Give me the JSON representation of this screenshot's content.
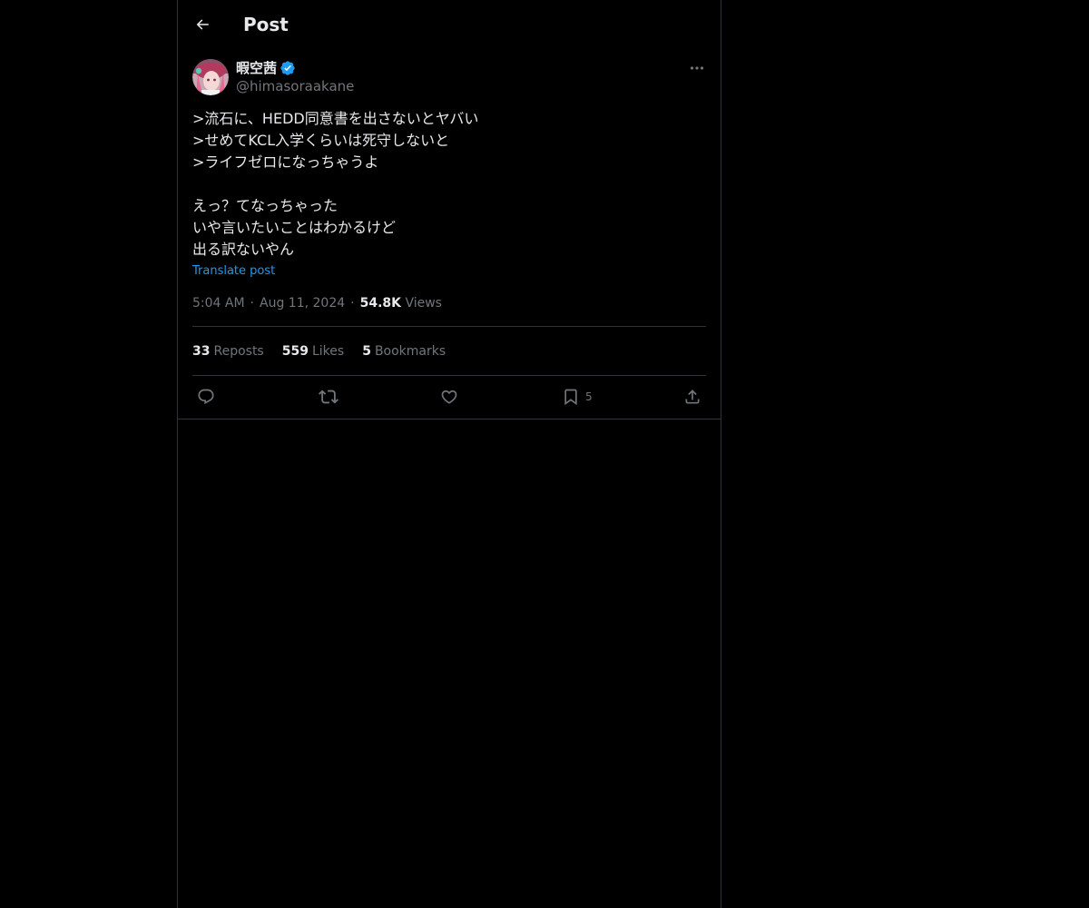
{
  "header": {
    "title": "Post",
    "back_icon": "arrow-left-icon"
  },
  "author": {
    "display_name": "暇空茜",
    "handle": "@himasoraakane",
    "verified": true,
    "verified_color": "#1d9bf0"
  },
  "post": {
    "lines": [
      ">流石に、HEDD同意書を出さないとヤバい",
      ">せめてKCL入学くらいは死守しないと",
      ">ライフゼロになっちゃうよ",
      "",
      "えっ？てなっちゃった",
      "いや言いたいことはわかるけど",
      "出る訳ないやん"
    ],
    "translate_label": "Translate post"
  },
  "meta": {
    "time": "5:04 AM",
    "separator": "·",
    "date": "Aug 11, 2024",
    "views_count": "54.8K",
    "views_label": "Views"
  },
  "stats": {
    "reposts_count": "33",
    "reposts_label": "Reposts",
    "likes_count": "559",
    "likes_label": "Likes",
    "bookmarks_count": "5",
    "bookmarks_label": "Bookmarks"
  },
  "actions": {
    "reply_icon": "reply-icon",
    "repost_icon": "repost-icon",
    "like_icon": "heart-icon",
    "bookmark_icon": "bookmark-icon",
    "bookmark_count": "5",
    "share_icon": "share-icon"
  },
  "colors": {
    "background": "#000000",
    "text": "#e7e9ea",
    "muted": "#71767b",
    "border": "#2f3336",
    "accent": "#1d9bf0"
  }
}
